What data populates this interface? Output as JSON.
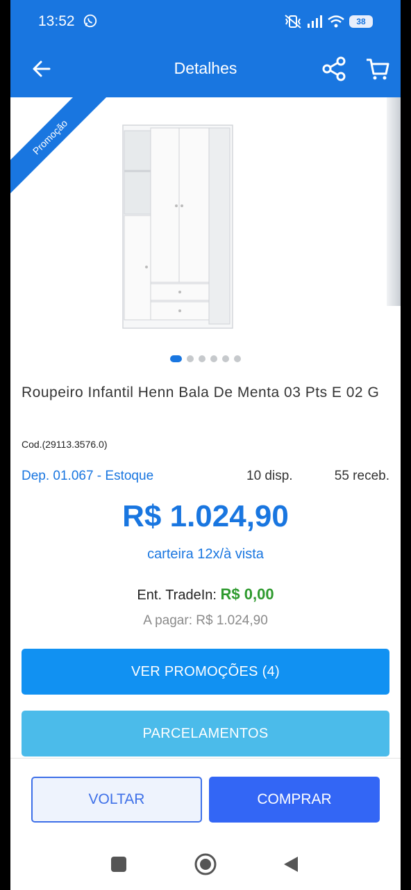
{
  "status_bar": {
    "time": "13:52",
    "battery": "38",
    "icons": [
      "whatsapp-icon",
      "mute-vibrate-icon",
      "signal-icon",
      "wifi-icon",
      "battery-icon"
    ]
  },
  "app_bar": {
    "title": "Detalhes",
    "icons": [
      "back-arrow-icon",
      "share-icon",
      "cart-icon"
    ],
    "color": "#1976e0"
  },
  "gallery": {
    "ribbon": "Promoção",
    "image_count": 6,
    "active_index": 0
  },
  "product": {
    "title": "Roupeiro Infantil Henn Bala De Menta 03 Pts E 02 G",
    "code": "Cod.(29113.3576.0)"
  },
  "stock": {
    "deposit": "Dep. 01.067 - Estoque",
    "available": "10 disp.",
    "incoming": "55 receb."
  },
  "pricing": {
    "price": "R$ 1.024,90",
    "payment_method": "carteira 12x/à vista",
    "tradein_label": "Ent. TradeIn:",
    "tradein_value": "R$ 0,00",
    "to_pay": "A pagar: R$ 1.024,90"
  },
  "actions": {
    "promotions": "VER PROMOÇÕES (4)",
    "installments": "PARCELAMENTOS",
    "back": "VOLTAR",
    "buy": "COMPRAR"
  },
  "colors": {
    "primary": "#1976e0",
    "promo_button": "#1191f2",
    "installments_button": "#4bbbea",
    "buy_button": "#3366f5",
    "tradein_value": "#2e9a2e"
  }
}
